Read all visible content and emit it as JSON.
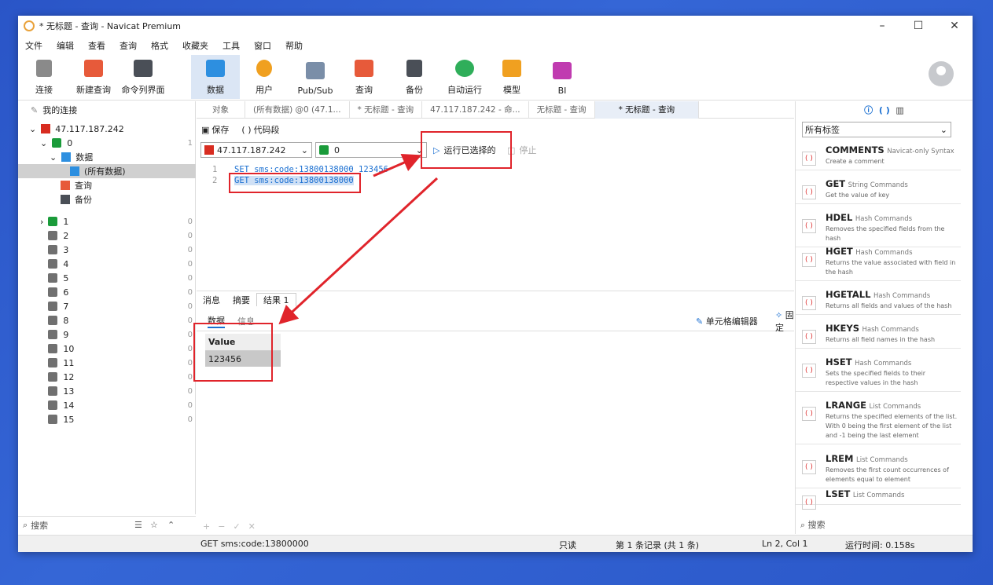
{
  "window": {
    "title": "* 无标题 - 查询 - Navicat Premium",
    "min": "–",
    "max": "☐",
    "close": "✕"
  },
  "menu": [
    "文件",
    "编辑",
    "查看",
    "查询",
    "格式",
    "收藏夹",
    "工具",
    "窗口",
    "帮助"
  ],
  "toolbar": {
    "connect": "连接",
    "new_query": "新建查询",
    "cli": "命令列界面",
    "data": "数据",
    "user": "用户",
    "pubsub": "Pub/Sub",
    "query": "查询",
    "backup": "备份",
    "automation": "自动运行",
    "model": "模型",
    "bi": "BI"
  },
  "colors": {
    "accent": "#1a6fd1",
    "highlight": "#e0242b",
    "active_tab": "#dbe6f5"
  },
  "left": {
    "header": "我的连接",
    "server": "47.117.187.242",
    "db0": "0",
    "db0_count": "1",
    "data_folder": "数据",
    "all_data": "(所有数据)",
    "query": "查询",
    "backup": "备份",
    "dbs": [
      {
        "n": "1",
        "c": "0"
      },
      {
        "n": "2",
        "c": "0"
      },
      {
        "n": "3",
        "c": "0"
      },
      {
        "n": "4",
        "c": "0"
      },
      {
        "n": "5",
        "c": "0"
      },
      {
        "n": "6",
        "c": "0"
      },
      {
        "n": "7",
        "c": "0"
      },
      {
        "n": "8",
        "c": "0"
      },
      {
        "n": "9",
        "c": "0"
      },
      {
        "n": "10",
        "c": "0"
      },
      {
        "n": "11",
        "c": "0"
      },
      {
        "n": "12",
        "c": "0"
      },
      {
        "n": "13",
        "c": "0"
      },
      {
        "n": "14",
        "c": "0"
      },
      {
        "n": "15",
        "c": "0"
      }
    ],
    "search": "搜索"
  },
  "tabs": [
    "对象",
    "(所有数据) @0 (47.1...",
    "* 无标题 - 查询",
    "47.117.187.242 - 命...",
    "无标题 - 查询",
    "* 无标题 - 查询"
  ],
  "query": {
    "save": "保存",
    "snippet": "代码段",
    "server": "47.117.187.242",
    "db": "0",
    "run_selected": "运行已选择的",
    "stop": "停止"
  },
  "editor": {
    "lines": [
      {
        "n": "1",
        "t": "SET sms:code:13800138000 123456"
      },
      {
        "n": "2",
        "t": "GET sms:code:13800138000"
      }
    ]
  },
  "results": {
    "tabs": [
      "消息",
      "摘要",
      "结果 1"
    ],
    "sub": [
      "数据",
      "信息"
    ],
    "cell_editor": "单元格编辑器",
    "pin": "固定",
    "column": "Value",
    "value": "123456"
  },
  "status": {
    "sql": "GET sms:code:13800000",
    "readonly": "只读",
    "records": "第 1 条记录 (共 1 条)",
    "pos": "Ln 2, Col 1",
    "time": "运行时间: 0.158s"
  },
  "right": {
    "filter": "所有标签",
    "search": "搜索",
    "cmds": [
      {
        "n": "COMMENTS",
        "c": "Navicat-only Syntax",
        "d": "Create a comment"
      },
      {
        "n": "GET",
        "c": "String Commands",
        "d": "Get the value of key"
      },
      {
        "n": "HDEL",
        "c": "Hash Commands",
        "d": "Removes the specified fields from the hash"
      },
      {
        "n": "HGET",
        "c": "Hash Commands",
        "d": "Returns the value associated with field in the hash"
      },
      {
        "n": "HGETALL",
        "c": "Hash Commands",
        "d": "Returns all fields and values of the hash"
      },
      {
        "n": "HKEYS",
        "c": "Hash Commands",
        "d": "Returns all field names in the hash"
      },
      {
        "n": "HSET",
        "c": "Hash Commands",
        "d": "Sets the specified fields to their respective values in the hash"
      },
      {
        "n": "LRANGE",
        "c": "List Commands",
        "d": "Returns the specified elements of the list. With 0 being the first element of the list and -1 being the last element"
      },
      {
        "n": "LREM",
        "c": "List Commands",
        "d": "Removes the first count occurrences of elements equal to element"
      },
      {
        "n": "LSET",
        "c": "List Commands",
        "d": ""
      }
    ]
  }
}
